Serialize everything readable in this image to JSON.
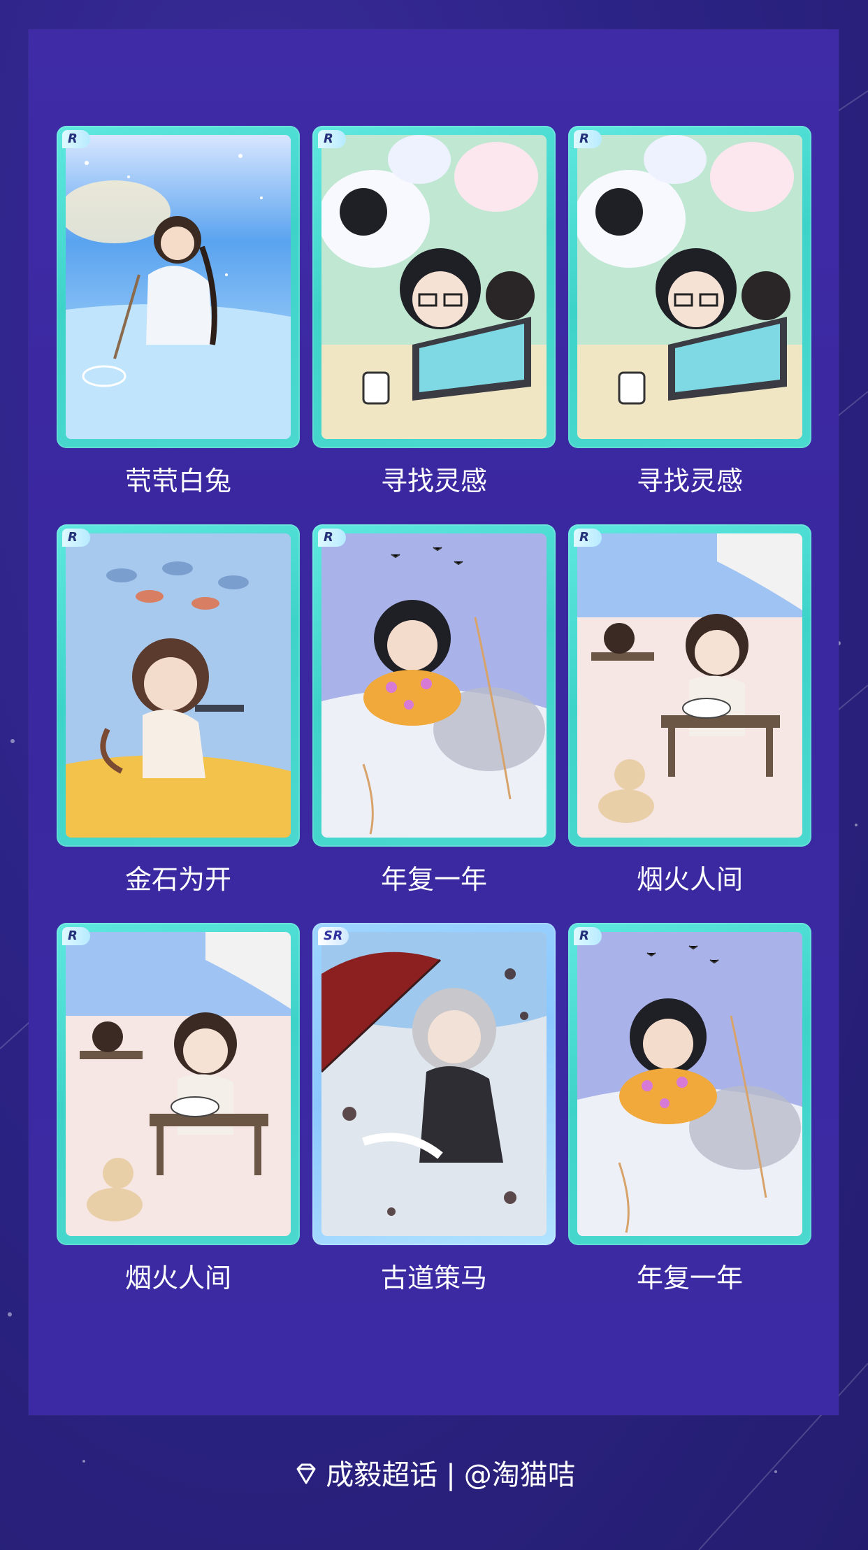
{
  "cards": [
    {
      "title": "茕茕白兔",
      "rarity": "R"
    },
    {
      "title": "寻找灵感",
      "rarity": "R"
    },
    {
      "title": "寻找灵感",
      "rarity": "R"
    },
    {
      "title": "金石为开",
      "rarity": "R"
    },
    {
      "title": "年复一年",
      "rarity": "R"
    },
    {
      "title": "烟火人间",
      "rarity": "R"
    },
    {
      "title": "烟火人间",
      "rarity": "R"
    },
    {
      "title": "古道策马",
      "rarity": "SR"
    },
    {
      "title": "年复一年",
      "rarity": "R"
    }
  ],
  "footer": {
    "topic": "成毅超话",
    "separator": "|",
    "author": "@淘猫咭",
    "icon": "diamond-icon"
  },
  "colors": {
    "background": "#2c2386",
    "panel": "#3b2aa3",
    "card_frame_r": "#3ed3c9",
    "card_frame_sr": "#8cc8ff",
    "text": "#ffffff"
  }
}
